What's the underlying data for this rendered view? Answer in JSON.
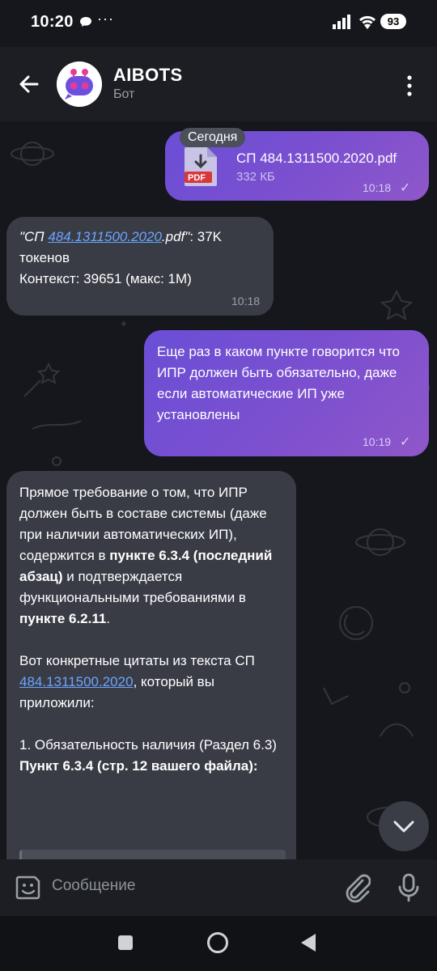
{
  "status_bar": {
    "time": "10:20",
    "battery": "93"
  },
  "header": {
    "title": "AIBOTS",
    "subtitle": "Бот"
  },
  "messages": {
    "date_chip": "Сегодня",
    "m1": {
      "file_name": "СП 484.1311500.2020.pdf",
      "file_size": "332 КБ",
      "file_type": "PDF",
      "time": "10:18"
    },
    "m2": {
      "quote_open": "\"СП ",
      "link": "484.1311500.2020",
      "quote_close": ".pdf\"",
      "tokens": ": 37K",
      "line2": "токенов",
      "line3": "Контекст: 39651 (макс: 1M)",
      "time": "10:18"
    },
    "m3": {
      "text": "Еще раз в каком пункте говорится что ИПР должен быть обязательно, даже если автоматические ИП уже установлены",
      "time": "10:19"
    },
    "m4": {
      "p1_a": "Прямое требование о том, что ИПР должен быть в составе системы (даже при наличии автоматических ИП), содержится в ",
      "p1_b": "пункте 6.3.4 (последний абзац)",
      "p1_c": " и подтверждается функциональными требованиями в ",
      "p1_d": "пункте 6.2.11",
      "p1_e": ".",
      "p2_a": "Вот конкретные цитаты из текста СП ",
      "p2_link": "484.1311500.2020",
      "p2_b": ", который вы приложили:",
      "p3_a": "1. Обязательность наличия (Раздел 6.3)",
      "p3_b": "Пункт 6.3.4 (стр. 12 вашего файла):"
    }
  },
  "input": {
    "placeholder": "Сообщение"
  },
  "icons": [
    "chat-bubble-icon",
    "signal-icon",
    "wifi-icon",
    "back-arrow-icon",
    "bot-avatar-icon",
    "more-vert-icon",
    "pdf-file-icon",
    "check-icon",
    "chevron-down-icon",
    "emoji-icon",
    "attach-icon",
    "mic-icon",
    "nav-recent-icon",
    "nav-home-icon",
    "nav-back-icon"
  ],
  "colors": {
    "outgoing_bubble": "#7a4fd0",
    "incoming_bubble": "#3a3c45",
    "link": "#6aa4ff",
    "pdf_badge": "#d9383a"
  }
}
